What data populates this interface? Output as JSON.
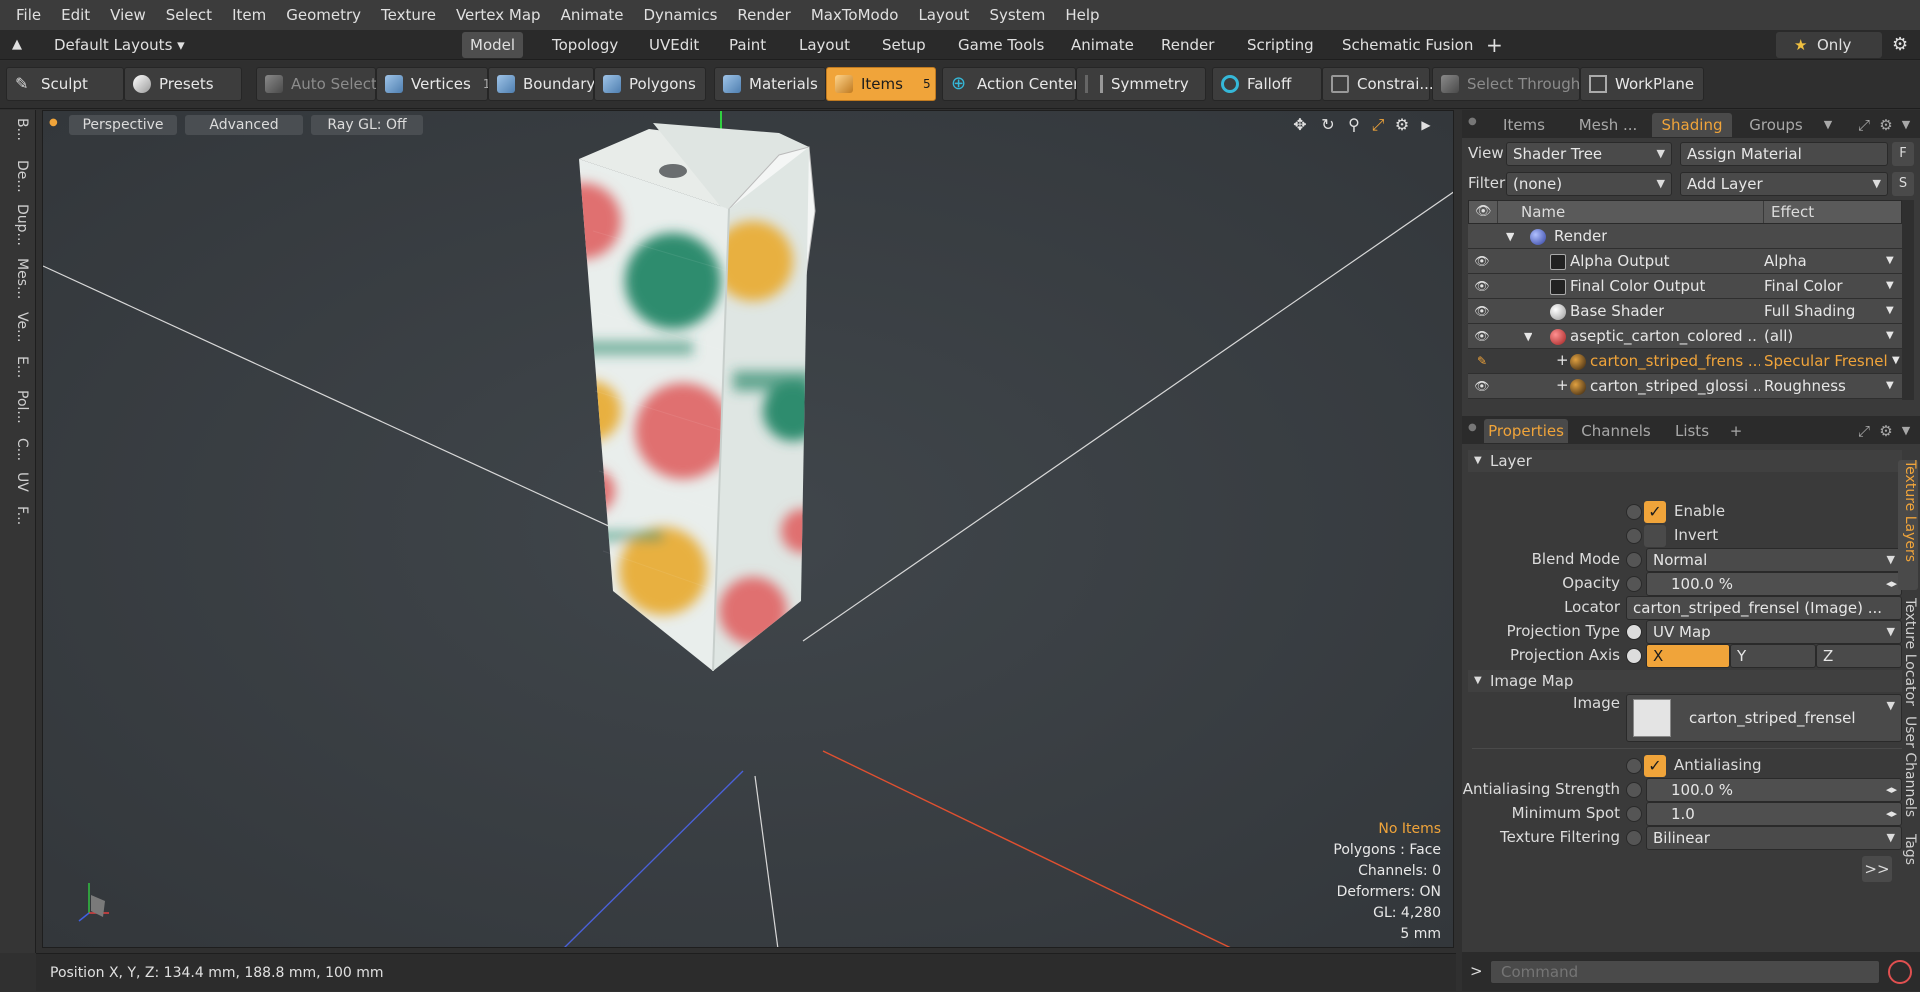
{
  "menubar": {
    "items": [
      "File",
      "Edit",
      "View",
      "Select",
      "Item",
      "Geometry",
      "Texture",
      "Vertex Map",
      "Animate",
      "Dynamics",
      "Render",
      "MaxToModo",
      "Layout",
      "System",
      "Help"
    ]
  },
  "tabbar": {
    "layout_menu": "Default Layouts",
    "tabs": [
      "Model",
      "Topology",
      "UVEdit",
      "Paint",
      "Layout",
      "Setup",
      "Game Tools",
      "Animate",
      "Render",
      "Scripting",
      "Schematic Fusion"
    ],
    "active_tab": "Model",
    "add": "+",
    "only": "Only"
  },
  "toolbar": {
    "sculpt": "Sculpt",
    "presets": "Presets",
    "auto_select": "Auto Select",
    "vertices": "Vertices",
    "vertices_count": "1",
    "boundary": "Boundary",
    "polygons": "Polygons",
    "materials": "Materials",
    "items": "Items",
    "items_count": "5",
    "action_center": "Action Center",
    "symmetry": "Symmetry",
    "falloff": "Falloff",
    "constraints": "Constrai...",
    "select_through": "Select Through",
    "workplane": "WorkPlane"
  },
  "left_tabs": [
    "B...",
    "De...",
    "Dup...",
    "Mes...",
    "Ve...",
    "E...",
    "Pol...",
    "C...",
    "UV",
    "F..."
  ],
  "viewport": {
    "view_mode": "Perspective",
    "advanced": "Advanced",
    "raygl": "Ray GL: Off",
    "info": {
      "items": "No Items",
      "polygons": "Polygons : Face",
      "channels": "Channels: 0",
      "deformers": "Deformers: ON",
      "gl": "GL: 4,280",
      "unit": "5 mm"
    }
  },
  "status": {
    "position": "Position X, Y, Z:   134.4 mm, 188.8 mm, 100 mm"
  },
  "shader_panel": {
    "tabs": [
      "Items",
      "Mesh ...",
      "Shading",
      "Groups"
    ],
    "active_tab": "Shading",
    "view_label": "View",
    "view_value": "Shader Tree",
    "assign_material": "Assign Material",
    "f_btn": "F",
    "filter_label": "Filter",
    "filter_value": "(none)",
    "add_layer": "Add Layer",
    "s_btn": "S",
    "col_name": "Name",
    "col_effect": "Effect",
    "rows": [
      {
        "name": "Render",
        "effect": ""
      },
      {
        "name": "Alpha Output",
        "effect": "Alpha"
      },
      {
        "name": "Final Color Output",
        "effect": "Final Color"
      },
      {
        "name": "Base Shader",
        "effect": "Full Shading"
      },
      {
        "name": "aseptic_carton_colored ...",
        "effect": "(all)"
      },
      {
        "name": "carton_striped_frens ...",
        "effect": "Specular Fresnel"
      },
      {
        "name": "carton_striped_glossi ...",
        "effect": "Roughness"
      }
    ]
  },
  "properties_panel": {
    "tabs": [
      "Properties",
      "Channels",
      "Lists"
    ],
    "active_tab": "Properties",
    "add": "+",
    "layer_section": "Layer",
    "enable": "Enable",
    "invert": "Invert",
    "blend_mode_label": "Blend Mode",
    "blend_mode": "Normal",
    "opacity_label": "Opacity",
    "opacity": "100.0 %",
    "locator_label": "Locator",
    "locator": "carton_striped_frensel (Image) ...",
    "projection_type_label": "Projection Type",
    "projection_type": "UV Map",
    "projection_axis_label": "Projection Axis",
    "axes": [
      "X",
      "Y",
      "Z"
    ],
    "active_axis": "X",
    "image_map_section": "Image Map",
    "image_label": "Image",
    "image": "carton_striped_frensel",
    "antialiasing": "Antialiasing",
    "aa_strength_label": "Antialiasing Strength",
    "aa_strength": "100.0 %",
    "min_spot_label": "Minimum Spot",
    "min_spot": "1.0",
    "tex_filter_label": "Texture Filtering",
    "tex_filter": "Bilinear",
    "more": ">>",
    "side_tabs": [
      "Texture Layers",
      "Texture Locator",
      "User Channels",
      "Tags"
    ],
    "active_side_tab": "Texture Layers"
  },
  "command": {
    "placeholder": "Command",
    "prompt": ">"
  },
  "colors": {
    "accent": "#f0a43a",
    "background": "#303030",
    "viewport": "#3a3e42"
  }
}
